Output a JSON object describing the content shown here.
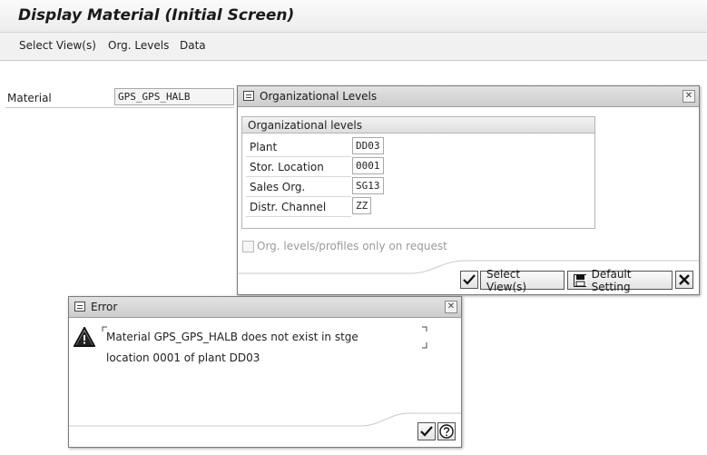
{
  "window": {
    "title": "Display Material (Initial Screen)"
  },
  "menu": [
    "Select View(s)",
    "Org. Levels",
    "Data"
  ],
  "material": {
    "label": "Material",
    "value": "GPS_GPS_HALB"
  },
  "org_dialog": {
    "title": "Organizational Levels",
    "group_title": "Organizational levels",
    "fields": [
      {
        "label": "Plant",
        "value": "DD03"
      },
      {
        "label": "Stor. Location",
        "value": "0001"
      },
      {
        "label": "Sales Org.",
        "value": "SG13"
      },
      {
        "label": "Distr. Channel",
        "value": "ZZ"
      }
    ],
    "checkbox_label": "Org. levels/profiles only on request",
    "buttons": {
      "select_views": "Select View(s)",
      "default_setting": "Default Setting"
    }
  },
  "error_dialog": {
    "title": "Error",
    "message_line1": "Material GPS_GPS_HALB does not exist in stge",
    "message_line2": "location 0001 of plant DD03"
  }
}
